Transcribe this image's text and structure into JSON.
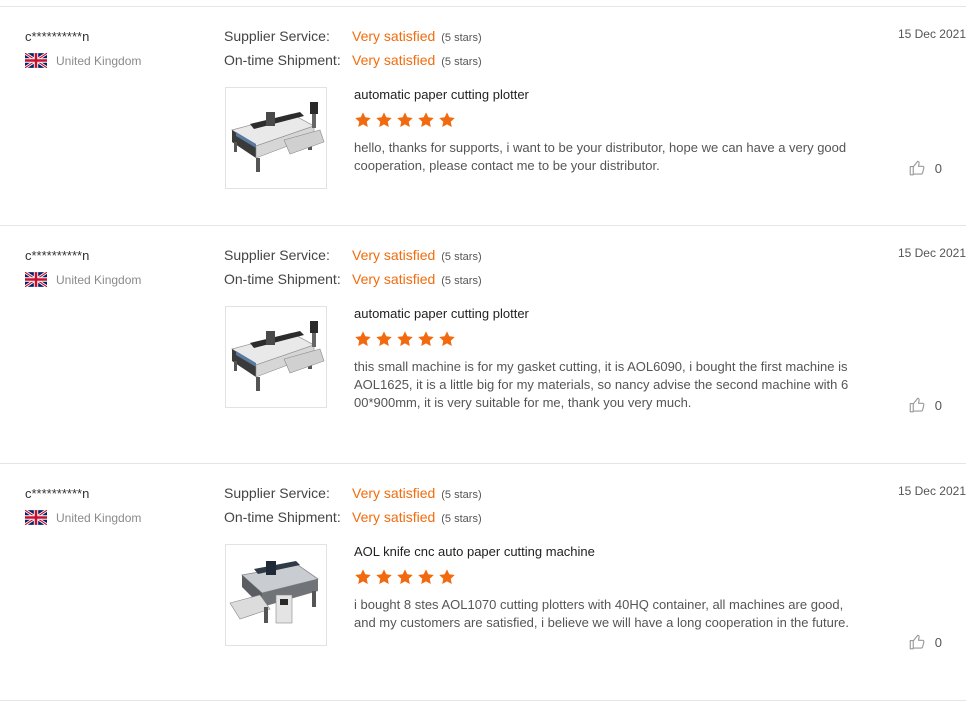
{
  "labels": {
    "supplier_service": "Supplier Service:",
    "on_time_shipment": "On-time Shipment:"
  },
  "colors": {
    "accent": "#f16c0d",
    "star": "#f26a0f"
  },
  "reviews": [
    {
      "buyer": "c**********n",
      "country": "United Kingdom",
      "date": "15 Dec 2021",
      "supplier_service": {
        "value": "Very satisfied",
        "stars": "(5 stars)"
      },
      "on_time_shipment": {
        "value": "Very satisfied",
        "stars": "(5 stars)"
      },
      "product": "automatic paper cutting plotter",
      "rating": 5,
      "comment": "hello, thanks for supports, i want to be your distributor, hope we can have a very good cooperation, please contact me to be your distributor.",
      "likes": "0",
      "image_icon": "cutting-plotter-machine-icon"
    },
    {
      "buyer": "c**********n",
      "country": "United Kingdom",
      "date": "15 Dec 2021",
      "supplier_service": {
        "value": "Very satisfied",
        "stars": "(5 stars)"
      },
      "on_time_shipment": {
        "value": "Very satisfied",
        "stars": "(5 stars)"
      },
      "product": "automatic paper cutting plotter",
      "rating": 5,
      "comment": "this small machine is for my gasket cutting, it is AOL6090, i bought the first machine is AOL1625, it is a little big for my materials, so nancy advise the second machine with 600*900mm, it is very suitable for me, thank you very much.",
      "likes": "0",
      "image_icon": "cutting-plotter-machine-icon"
    },
    {
      "buyer": "c**********n",
      "country": "United Kingdom",
      "date": "15 Dec 2021",
      "supplier_service": {
        "value": "Very satisfied",
        "stars": "(5 stars)"
      },
      "on_time_shipment": {
        "value": "Very satisfied",
        "stars": "(5 stars)"
      },
      "product": "AOL knife cnc auto paper cutting machine",
      "rating": 5,
      "comment": "i bought 8 stes AOL1070 cutting plotters with 40HQ container, all machines are good, and my customers are satisfied, i believe we will have a long cooperation in the future.",
      "likes": "0",
      "image_icon": "cnc-cutting-machine-icon"
    }
  ]
}
